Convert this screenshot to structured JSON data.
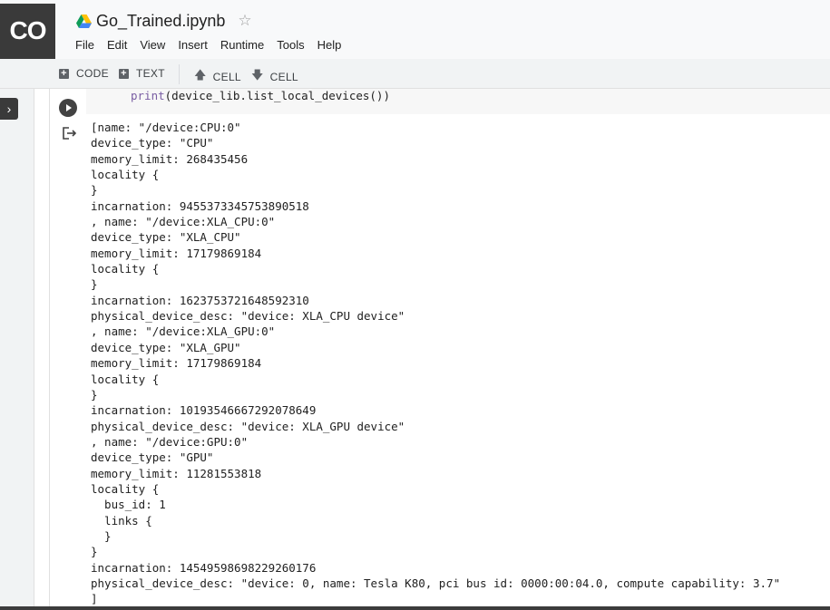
{
  "app": {
    "logo_text": "CO",
    "notebook_title": "Go_Trained.ipynb"
  },
  "menu": [
    "File",
    "Edit",
    "View",
    "Insert",
    "Runtime",
    "Tools",
    "Help"
  ],
  "toolbar": {
    "add_code": "CODE",
    "add_text": "TEXT",
    "cell_up": "CELL",
    "cell_down": "CELL"
  },
  "cell": {
    "code_keyword": "print",
    "code_rest": "(device_lib.list_local_devices())"
  },
  "output_lines": [
    "[name: \"/device:CPU:0\"",
    "device_type: \"CPU\"",
    "memory_limit: 268435456",
    "locality {",
    "}",
    "incarnation: 9455373345753890518",
    ", name: \"/device:XLA_CPU:0\"",
    "device_type: \"XLA_CPU\"",
    "memory_limit: 17179869184",
    "locality {",
    "}",
    "incarnation: 1623753721648592310",
    "physical_device_desc: \"device: XLA_CPU device\"",
    ", name: \"/device:XLA_GPU:0\"",
    "device_type: \"XLA_GPU\"",
    "memory_limit: 17179869184",
    "locality {",
    "}",
    "incarnation: 10193546667292078649",
    "physical_device_desc: \"device: XLA_GPU device\"",
    ", name: \"/device:GPU:0\"",
    "device_type: \"GPU\"",
    "memory_limit: 11281553818",
    "locality {",
    "  bus_id: 1",
    "  links {",
    "  }",
    "}",
    "incarnation: 14549598698229260176",
    "physical_device_desc: \"device: 0, name: Tesla K80, pci bus id: 0000:00:04.0, compute capability: 3.7\"",
    "]"
  ],
  "icons": {
    "drive": "google-drive-icon",
    "star": "star-icon",
    "run": "play-icon",
    "output": "output-redirect-icon",
    "sidebar": "chevron-right-icon"
  },
  "colors": {
    "logo_bg": "#3a3a3a",
    "keyword": "#795da3",
    "toolbar_bg": "#f1f3f4"
  }
}
